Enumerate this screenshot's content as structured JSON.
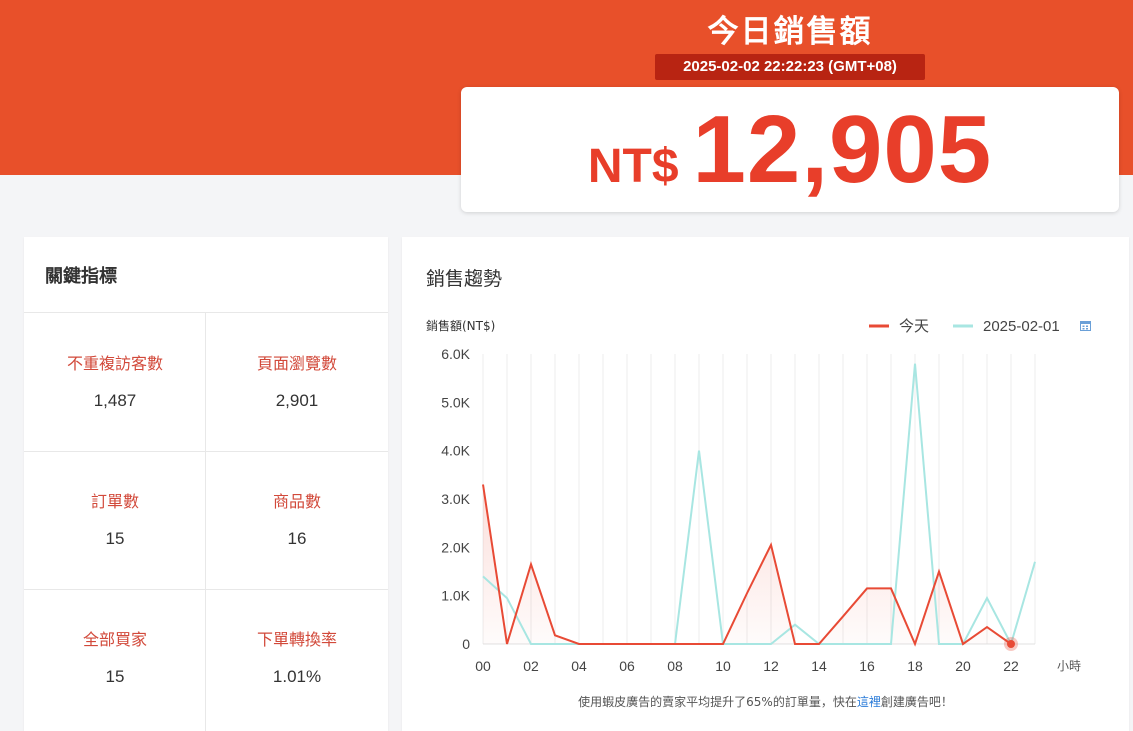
{
  "header": {
    "title": "今日銷售額",
    "timestamp": "2025-02-02 22:22:23 (GMT+08)",
    "currency": "NT$",
    "sales_value": "12,905"
  },
  "metrics": {
    "title": "關鍵指標",
    "items": [
      {
        "label": "不重複訪客數",
        "value": "1,487"
      },
      {
        "label": "頁面瀏覽數",
        "value": "2,901"
      },
      {
        "label": "訂單數",
        "value": "15"
      },
      {
        "label": "商品數",
        "value": "16"
      },
      {
        "label": "全部買家",
        "value": "15"
      },
      {
        "label": "下單轉換率",
        "value": "1.01%"
      }
    ]
  },
  "trend": {
    "title": "銷售趨勢",
    "ad_prefix": "使用蝦皮廣告的賣家平均提升了65%的訂單量，快在",
    "ad_link": "這裡",
    "ad_suffix": "創建廣告吧！",
    "calendar_icon": "calendar-icon"
  },
  "colors": {
    "brand": "#e8502a",
    "brand_dark": "#b82412",
    "accent_text": "#d2493a",
    "today_series": "#e84a35",
    "yesterday_series": "#a8e6e2"
  },
  "chart_data": {
    "type": "line",
    "ylabel": "銷售額(NT$)",
    "xlabel": "小時",
    "ylim": [
      0,
      6000
    ],
    "y_ticks": [
      "0",
      "1.0K",
      "2.0K",
      "3.0K",
      "4.0K",
      "5.0K",
      "6.0K"
    ],
    "x_ticks": [
      "00",
      "02",
      "04",
      "06",
      "08",
      "10",
      "12",
      "14",
      "16",
      "18",
      "20",
      "22"
    ],
    "x": [
      0,
      1,
      2,
      3,
      4,
      5,
      6,
      7,
      8,
      9,
      10,
      11,
      12,
      13,
      14,
      15,
      16,
      17,
      18,
      19,
      20,
      21,
      22,
      23
    ],
    "legend_position": "top-right",
    "grid": true,
    "series": [
      {
        "name": "今天",
        "values": [
          3300,
          0,
          1650,
          180,
          0,
          0,
          0,
          0,
          0,
          0,
          0,
          1050,
          2050,
          0,
          0,
          570,
          1150,
          1150,
          0,
          1500,
          0,
          350,
          0,
          null
        ]
      },
      {
        "name": "2025-02-01",
        "values": [
          1400,
          950,
          0,
          0,
          0,
          0,
          0,
          0,
          0,
          4000,
          0,
          0,
          0,
          400,
          0,
          0,
          0,
          0,
          5800,
          0,
          0,
          950,
          0,
          1700
        ]
      }
    ]
  }
}
